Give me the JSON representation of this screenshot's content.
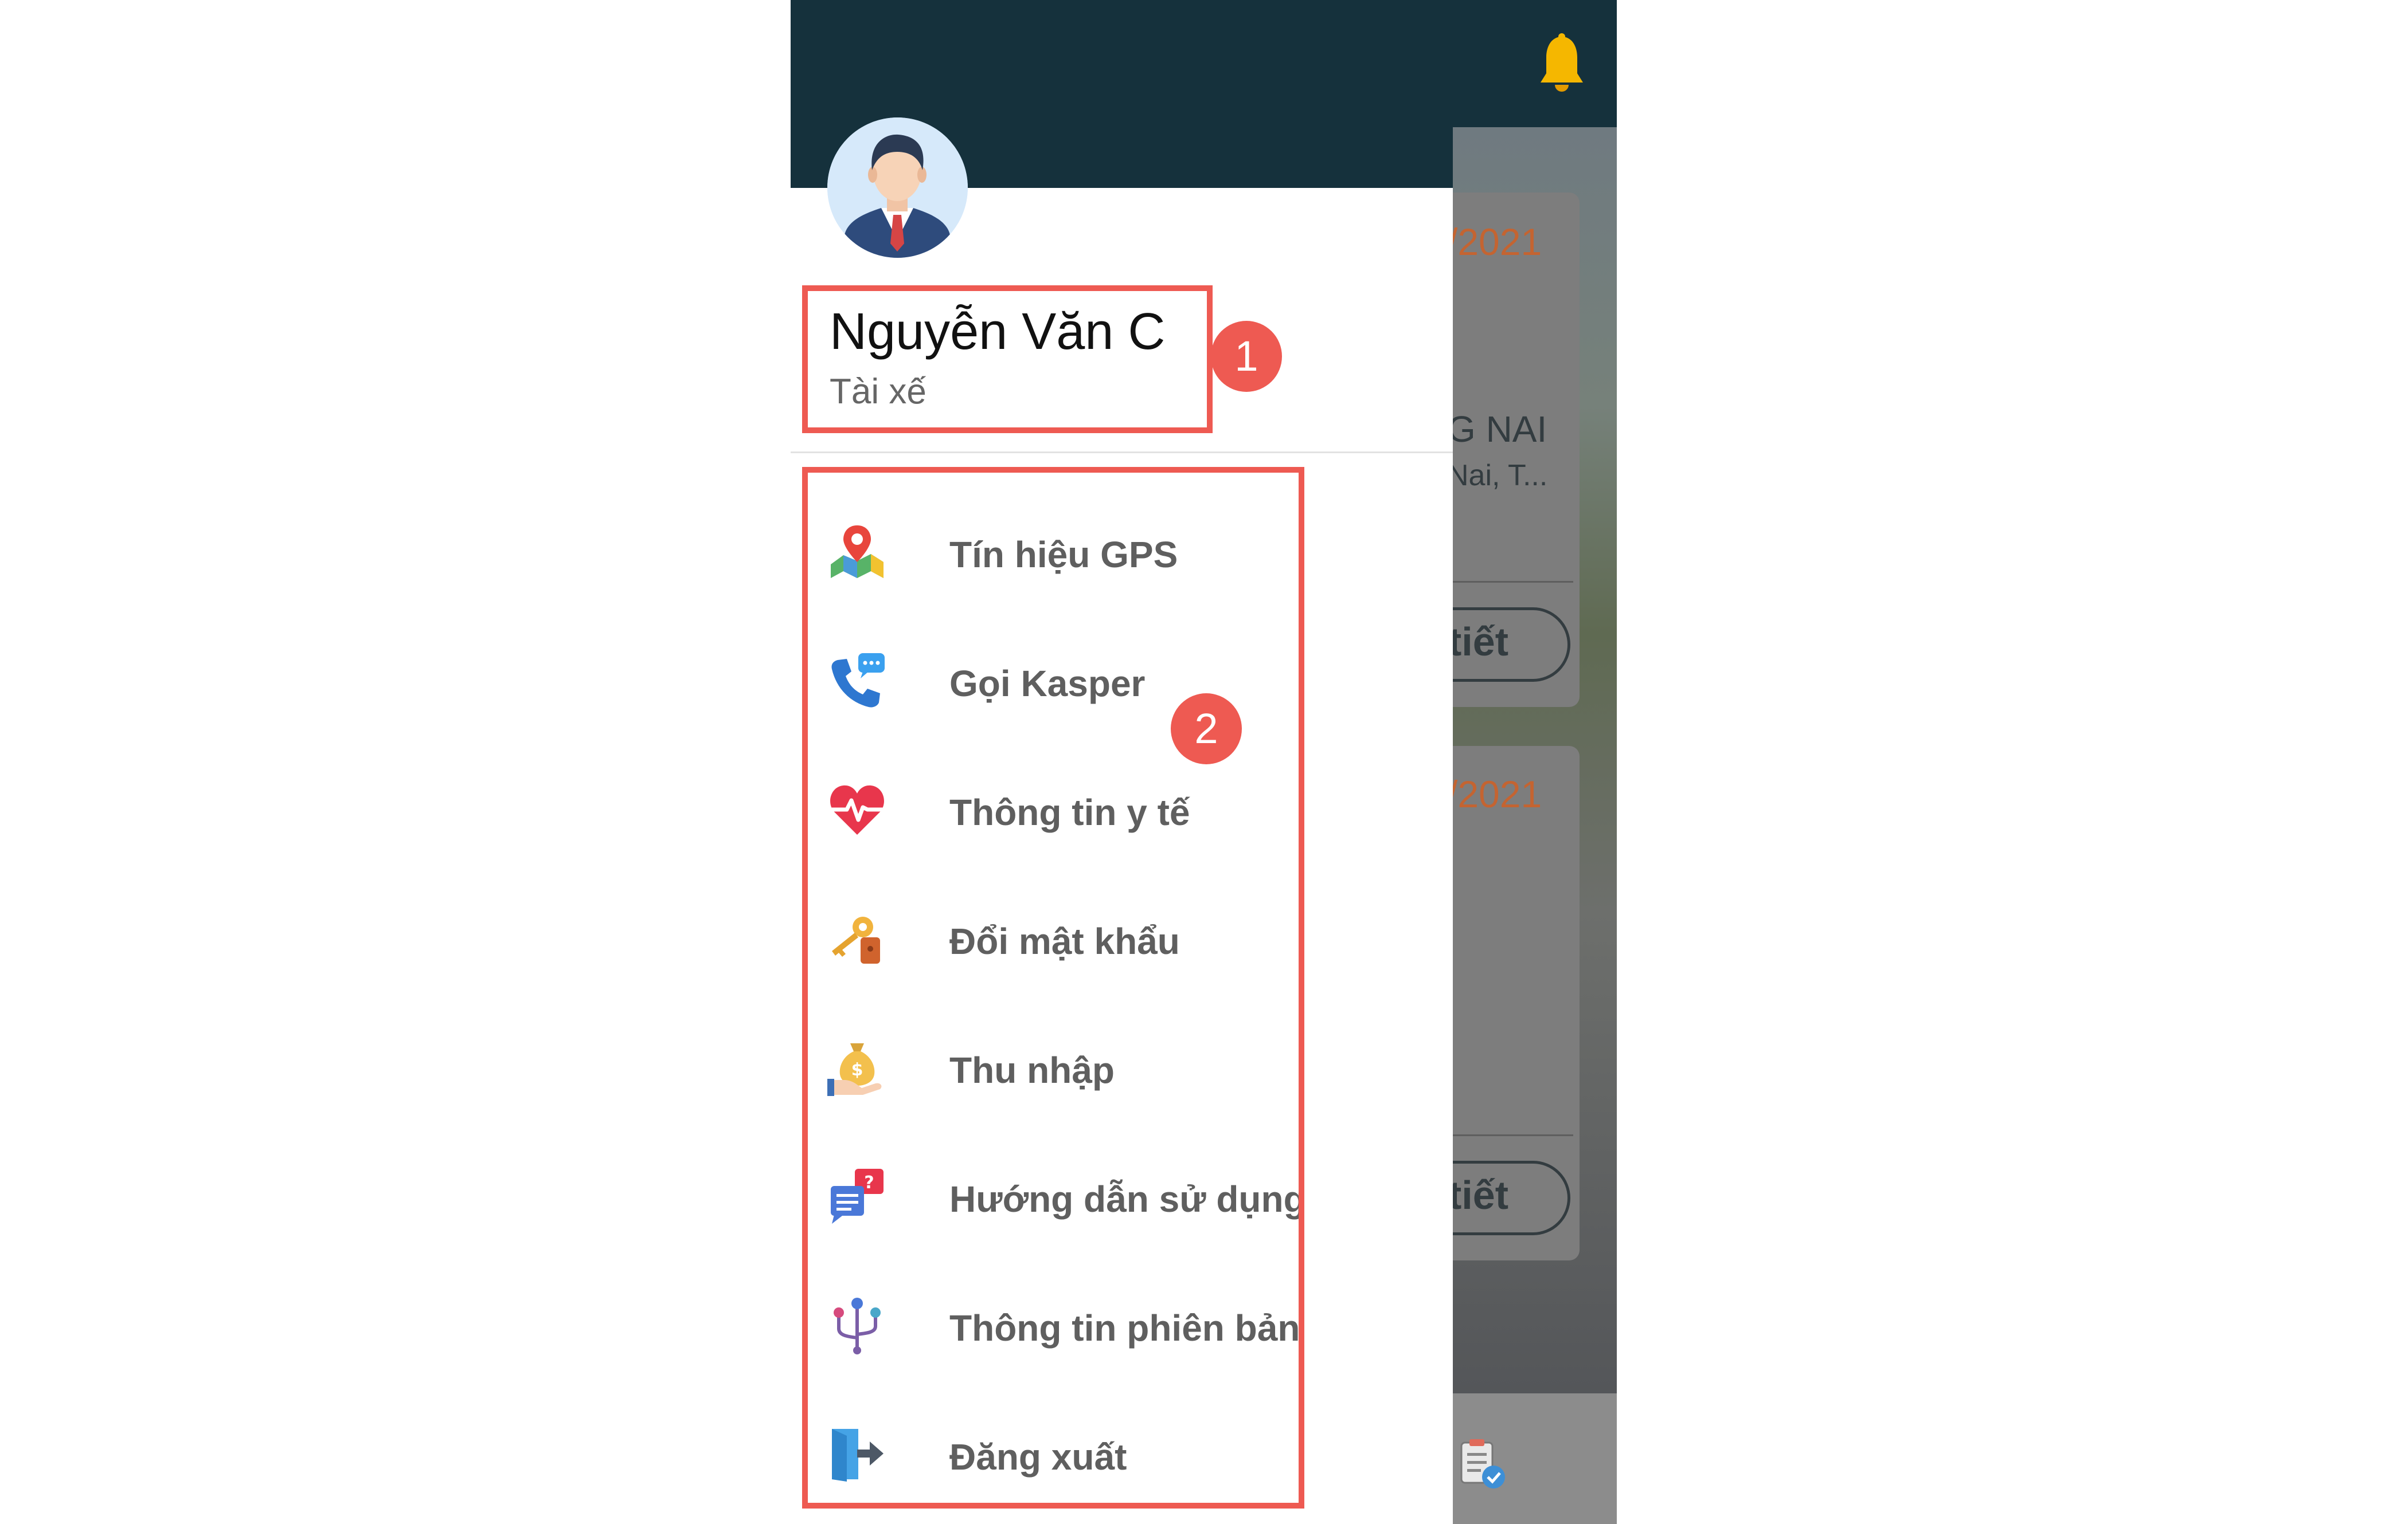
{
  "background_app": {
    "dates": [
      "/2021",
      "/2021"
    ],
    "location_title": "G NAI",
    "location_address": "Nai, T...",
    "detail_buttons": [
      "tiết",
      "tiết"
    ]
  },
  "drawer": {
    "user": {
      "name": "Nguyễn Văn C",
      "role": "Tài xế"
    },
    "menu": [
      {
        "label": "Tín hiệu GPS",
        "icon": "map-pin-icon"
      },
      {
        "label": "Gọi Kasper",
        "icon": "phone-chat-icon"
      },
      {
        "label": "Thông tin y tế",
        "icon": "heart-pulse-icon"
      },
      {
        "label": "Đổi mật khẩu",
        "icon": "key-icon"
      },
      {
        "label": "Thu nhập",
        "icon": "money-bag-icon"
      },
      {
        "label": "Hướng dẫn sử dụng",
        "icon": "help-chat-icon"
      },
      {
        "label": "Thông tin phiên bản",
        "icon": "version-branch-icon"
      },
      {
        "label": "Đăng xuất",
        "icon": "logout-icon"
      }
    ]
  },
  "annotations": {
    "badge_1": "1",
    "badge_2": "2"
  },
  "colors": {
    "header": "#15313c",
    "annotation": "#ee5a52",
    "menu_text": "#5f5f5f",
    "date_accent": "#c46431"
  }
}
